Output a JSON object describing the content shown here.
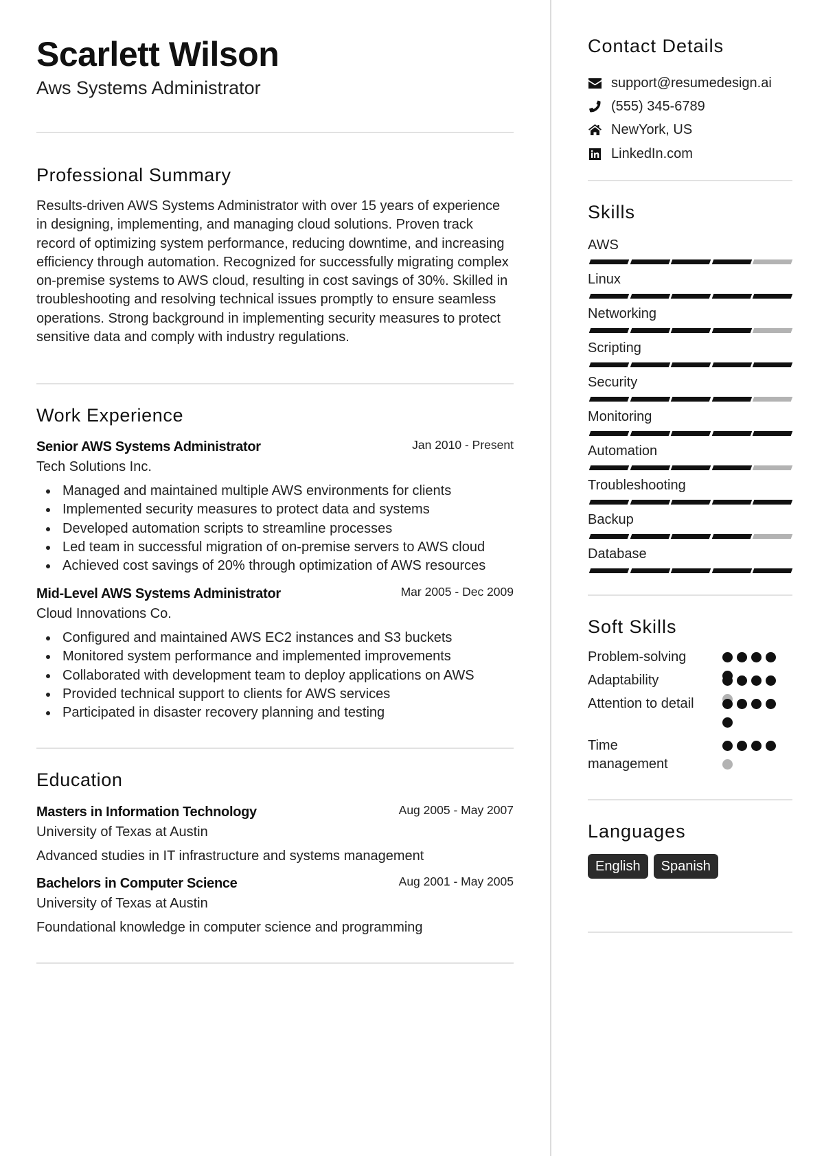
{
  "header": {
    "name": "Scarlett Wilson",
    "title": "Aws Systems Administrator"
  },
  "summary": {
    "heading": "Professional Summary",
    "text": "Results-driven AWS Systems Administrator with over 15 years of experience in designing, implementing, and managing cloud solutions. Proven track record of optimizing system performance, reducing downtime, and increasing efficiency through automation. Recognized for successfully migrating complex on-premise systems to AWS cloud, resulting in cost savings of 30%. Skilled in troubleshooting and resolving technical issues promptly to ensure seamless operations. Strong background in implementing security measures to protect sensitive data and comply with industry regulations."
  },
  "experience": {
    "heading": "Work Experience",
    "jobs": [
      {
        "title": "Senior AWS Systems Administrator",
        "dates": "Jan 2010 - Present",
        "company": "Tech Solutions Inc.",
        "bullets": [
          "Managed and maintained multiple AWS environments for clients",
          "Implemented security measures to protect data and systems",
          "Developed automation scripts to streamline processes",
          "Led team in successful migration of on-premise servers to AWS cloud",
          "Achieved cost savings of 20% through optimization of AWS resources"
        ]
      },
      {
        "title": "Mid-Level AWS Systems Administrator",
        "dates": "Mar 2005 - Dec 2009",
        "company": "Cloud Innovations Co.",
        "bullets": [
          "Configured and maintained AWS EC2 instances and S3 buckets",
          "Monitored system performance and implemented improvements",
          "Collaborated with development team to deploy applications on AWS",
          "Provided technical support to clients for AWS services",
          "Participated in disaster recovery planning and testing"
        ]
      }
    ]
  },
  "education": {
    "heading": "Education",
    "items": [
      {
        "degree": "Masters in Information Technology",
        "dates": "Aug 2005 - May 2007",
        "school": "University of Texas at Austin",
        "description": "Advanced studies in IT infrastructure and systems management"
      },
      {
        "degree": "Bachelors in Computer Science",
        "dates": "Aug 2001 - May 2005",
        "school": "University of Texas at Austin",
        "description": "Foundational knowledge in computer science and programming"
      }
    ]
  },
  "contact": {
    "heading": "Contact Details",
    "items": [
      {
        "icon": "envelope-icon",
        "text": "support@resumedesign.ai"
      },
      {
        "icon": "phone-icon",
        "text": "(555) 345-6789"
      },
      {
        "icon": "home-icon",
        "text": "NewYork, US"
      },
      {
        "icon": "linkedin-icon",
        "text": "LinkedIn.com"
      }
    ]
  },
  "skills": {
    "heading": "Skills",
    "max": 5,
    "items": [
      {
        "name": "AWS",
        "level": 4
      },
      {
        "name": "Linux",
        "level": 5
      },
      {
        "name": "Networking",
        "level": 4
      },
      {
        "name": "Scripting",
        "level": 5
      },
      {
        "name": "Security",
        "level": 4
      },
      {
        "name": "Monitoring",
        "level": 5
      },
      {
        "name": "Automation",
        "level": 4
      },
      {
        "name": "Troubleshooting",
        "level": 5
      },
      {
        "name": "Backup",
        "level": 4
      },
      {
        "name": "Database",
        "level": 5
      }
    ]
  },
  "soft_skills": {
    "heading": "Soft Skills",
    "max": 5,
    "items": [
      {
        "name": "Problem-solving",
        "level": 5
      },
      {
        "name": "Adaptability",
        "level": 4
      },
      {
        "name": "Attention to detail",
        "level": 5
      },
      {
        "name": "Time management",
        "level": 4
      }
    ]
  },
  "languages": {
    "heading": "Languages",
    "items": [
      "English",
      "Spanish"
    ]
  },
  "colors": {
    "filled": "#111111",
    "empty": "#b3b3b3",
    "badge": "#2b2b2b",
    "divider": "#e2e2e2"
  }
}
